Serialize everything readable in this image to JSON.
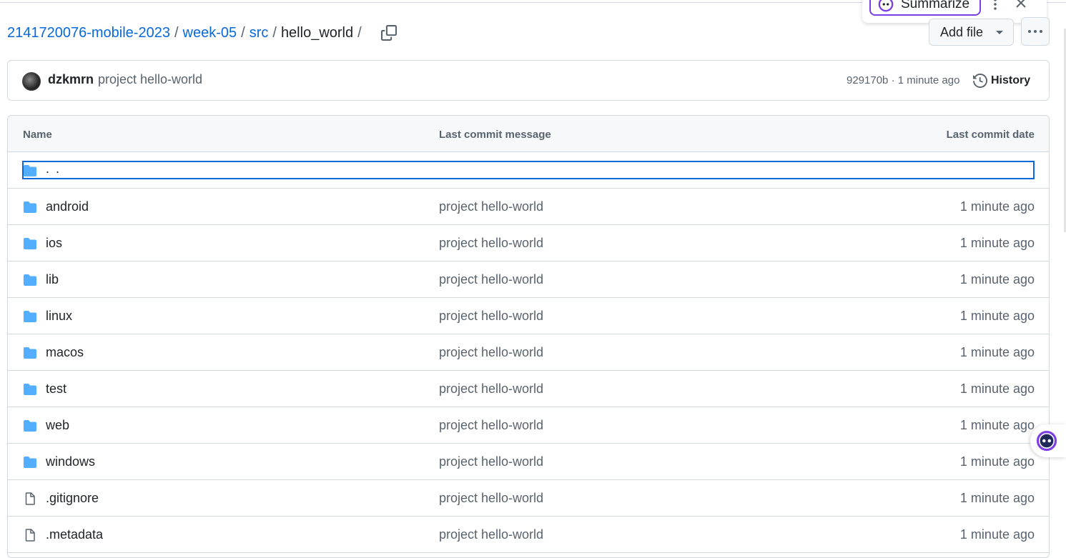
{
  "breadcrumb": {
    "repo": "2141720076-mobile-2023",
    "folder1": "week-05",
    "folder2": "src",
    "current": "hello_world",
    "separator": "/"
  },
  "summarize_popup": {
    "label": "Summarize",
    "accent": "#7b3fe4"
  },
  "toolbar": {
    "add_file_label": "Add file"
  },
  "commit": {
    "author": "dzkmrn",
    "message": "project hello-world",
    "meta": "929170b · 1 minute ago",
    "history_label": "History"
  },
  "table": {
    "headers": {
      "name": "Name",
      "message": "Last commit message",
      "date": "Last commit date"
    },
    "parent_label": ". .",
    "rows": [
      {
        "name": "android",
        "type": "folder",
        "message": "project hello-world",
        "date": "1 minute ago"
      },
      {
        "name": "ios",
        "type": "folder",
        "message": "project hello-world",
        "date": "1 minute ago"
      },
      {
        "name": "lib",
        "type": "folder",
        "message": "project hello-world",
        "date": "1 minute ago"
      },
      {
        "name": "linux",
        "type": "folder",
        "message": "project hello-world",
        "date": "1 minute ago"
      },
      {
        "name": "macos",
        "type": "folder",
        "message": "project hello-world",
        "date": "1 minute ago"
      },
      {
        "name": "test",
        "type": "folder",
        "message": "project hello-world",
        "date": "1 minute ago"
      },
      {
        "name": "web",
        "type": "folder",
        "message": "project hello-world",
        "date": "1 minute ago"
      },
      {
        "name": "windows",
        "type": "folder",
        "message": "project hello-world",
        "date": "1 minute ago"
      },
      {
        "name": ".gitignore",
        "type": "file",
        "message": "project hello-world",
        "date": "1 minute ago"
      },
      {
        "name": ".metadata",
        "type": "file",
        "message": "project hello-world",
        "date": "1 minute ago"
      }
    ]
  },
  "colors": {
    "link": "#0969da",
    "folder": "#54aeff",
    "muted": "#59636e",
    "border": "#d1d9e0"
  }
}
